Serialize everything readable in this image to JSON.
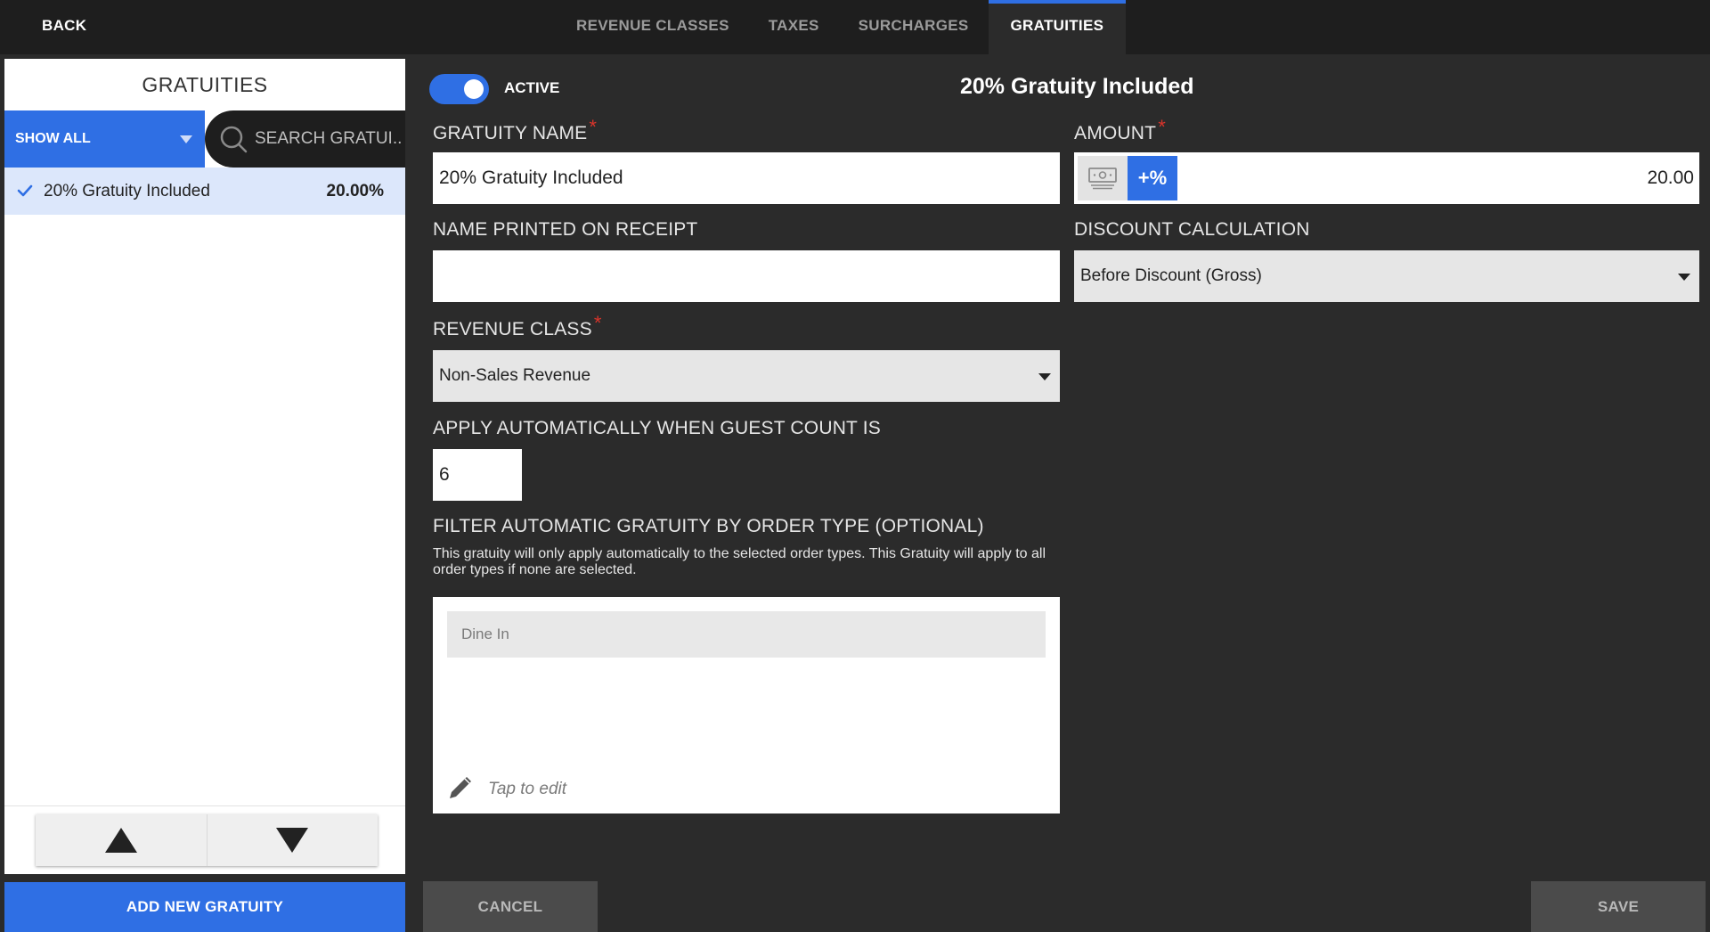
{
  "topbar": {
    "back_label": "BACK",
    "tabs": [
      {
        "label": "REVENUE CLASSES",
        "active": false
      },
      {
        "label": "TAXES",
        "active": false
      },
      {
        "label": "SURCHARGES",
        "active": false
      },
      {
        "label": "GRATUITIES",
        "active": true
      }
    ]
  },
  "sidebar": {
    "title": "GRATUITIES",
    "filter_label": "SHOW ALL",
    "search_placeholder": "SEARCH GRATUI...",
    "items": [
      {
        "name": "20% Gratuity Included",
        "percent": "20.00%",
        "selected": true
      }
    ],
    "add_button_label": "ADD NEW GRATUITY"
  },
  "form": {
    "active_label": "ACTIVE",
    "active": true,
    "record_title": "20% Gratuity Included",
    "gratuity_name_label": "GRATUITY NAME",
    "gratuity_name_value": "20% Gratuity Included",
    "amount_label": "AMOUNT",
    "amount_pct_label": "+%",
    "amount_value": "20.00",
    "receipt_name_label": "NAME PRINTED ON RECEIPT",
    "receipt_name_value": "",
    "discount_calc_label": "DISCOUNT CALCULATION",
    "discount_calc_value": "Before Discount (Gross)",
    "revenue_class_label": "REVENUE CLASS",
    "revenue_class_value": "Non-Sales Revenue",
    "guest_count_label": "APPLY AUTOMATICALLY WHEN GUEST COUNT IS",
    "guest_count_value": "6",
    "order_type_label": "FILTER AUTOMATIC GRATUITY BY ORDER TYPE (OPTIONAL)",
    "order_type_help": "This gratuity will only apply automatically to the selected order types. This Gratuity will apply to all order types if none are selected.",
    "order_types": [
      "Dine In"
    ],
    "tap_to_edit": "Tap to edit",
    "required_mark": "*"
  },
  "footer": {
    "cancel_label": "CANCEL",
    "save_label": "SAVE"
  },
  "colors": {
    "accent": "#2f6fe4",
    "background": "#2b2b2b",
    "topbar": "#1e1e1e",
    "required": "#d9342b"
  }
}
